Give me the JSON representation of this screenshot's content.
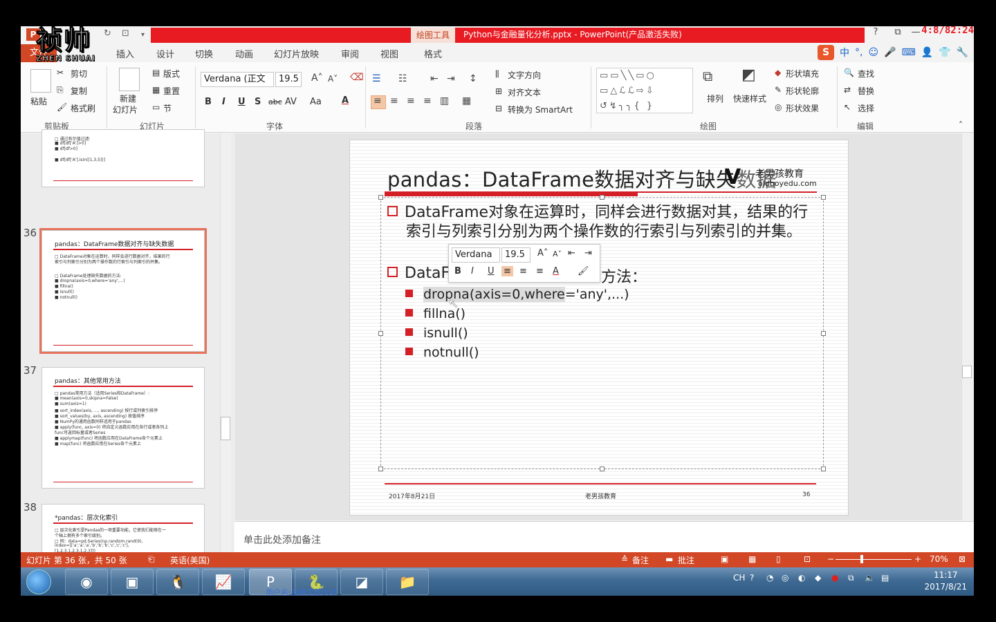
{
  "window": {
    "app_icon": "P",
    "drawing_tools_tab": "绘图工具",
    "title": "Python与金融量化分析.pptx -  PowerPoint(产品激活失败)",
    "help": "?",
    "restore": "⧉",
    "minimize": "—",
    "close": "✕",
    "overlay_timer": "4:8/82:24"
  },
  "tabs": {
    "file": "文件",
    "insert": "插入",
    "design": "设计",
    "transitions": "切换",
    "animations": "动画",
    "slideshow": "幻灯片放映",
    "review": "审阅",
    "view": "视图",
    "format": "格式"
  },
  "ime": {
    "logo": "S",
    "mode": "中"
  },
  "ribbon": {
    "clipboard": {
      "paste": "粘贴",
      "cut": "剪切",
      "copy": "复制",
      "format_painter": "格式刷",
      "label": "剪贴板"
    },
    "slides": {
      "new_slide": "新建",
      "new_slide2": "幻灯片",
      "layout": "版式",
      "reset": "重置",
      "section": "节",
      "label": "幻灯片"
    },
    "font": {
      "name": "Verdana (正文",
      "size": "19.5",
      "label": "字体",
      "bold": "B",
      "italic": "I",
      "underline": "U",
      "shadow": "S",
      "strike": "abc",
      "spacing": "AV",
      "case": "Aa",
      "color": "A"
    },
    "paragraph": {
      "text_direction": "文字方向",
      "align_text": "对齐文本",
      "smartart": "转换为 SmartArt",
      "label": "段落"
    },
    "drawing": {
      "arrange": "排列",
      "quick_styles": "快速样式",
      "shape_fill": "形状填充",
      "shape_outline": "形状轮廓",
      "shape_effects": "形状效果",
      "label": "绘图"
    },
    "editing": {
      "find": "查找",
      "replace": "替换",
      "select": "选择",
      "label": "编辑"
    }
  },
  "thumbnails": [
    {
      "number": "",
      "lines": [
        "□ 通过布尔值过滤:",
        "  ■ df[df['A']>0]",
        "  ■ df[df>0]",
        "",
        "  ■ df[df['A'].isin([1,3,5])]"
      ]
    },
    {
      "number": "36",
      "title": "pandas：DataFrame数据对齐与缺失数据",
      "lines": [
        "□ DataFrame对象在运算时，同样会进行数据对齐，结果的行",
        "   索引与列索引分别为两个操作数的行索引与列索引的并集。",
        "",
        "□ DataFrame处理缺失数据的方法:",
        "  ■ dropna(axis=0,where='any',...)",
        "  ■ fillna()",
        "  ■ isnull()",
        "  ■ notnull()"
      ]
    },
    {
      "number": "37",
      "title": "pandas：其他常用方法",
      "lines": [
        "□ pandas常用方法（适用Series和DataFrame）:",
        "  ■ mean(axis=0,skipna=False)",
        "  ■ sum(axis=1)",
        "  ■ sort_index(axis, ..., ascending)    按行或列索引排序",
        "  ■ sort_values(by, axis, ascending)    按值排序",
        "  ■ NumPy的通用函数同样适用于pandas",
        "  ■ apply(func, axis=0)     将自定义函数应用在各行或者各列上",
        "                 func可返回标量或者Series",
        "  ■ applymap(func)          将函数应用在DataFrame各个元素上",
        "  ■ map(func)               将函数应用在Series各个元素上"
      ]
    },
    {
      "number": "38",
      "title": "*pandas：层次化索引",
      "lines": [
        "□ 层次化索引是Pandas的一项重要功能，它使我们能够在一",
        "   个轴上拥有多个索引级别。",
        "□ 例：data=pd.Series(np.random.rand(9),",
        "   index=[['a','a','a','b','b','b','c','c','c'],",
        "   [1,2,3,1,2,3,1,2,3]])"
      ]
    }
  ],
  "slide": {
    "title_main": "pandas：DataFrame数据对齐与缺失",
    "title_tail": "数据",
    "logo_mark": "V",
    "logo_name": "老男孩教育",
    "logo_url": "oldboyedu.com",
    "para1_line1": "DataFrame对象在运算时，同样会进行数据对其，结果的行",
    "para1_line2": "索引与列索引分别为两个操作数的行索引与列索引的并集。",
    "para2_start": "DataF",
    "para2_end": "方法：",
    "items": [
      {
        "hl": "dropna(axis=0,where",
        "rest": "='any',...)"
      },
      {
        "hl": "",
        "rest": "fillna()"
      },
      {
        "hl": "",
        "rest": "isnull()"
      },
      {
        "hl": "",
        "rest": "notnull()"
      }
    ],
    "footer_date": "2017年8月21日",
    "footer_mid": "老男孩教育",
    "footer_page": "36"
  },
  "mini_toolbar": {
    "font": "Verdana",
    "size": "19.5"
  },
  "notes_placeholder": "单击此处添加备注",
  "status": {
    "slide_info": "幻灯片 第 36 张，共 50 张",
    "language": "英语(美国)",
    "notes": "备注",
    "comments": "批注",
    "zoom": "70%"
  },
  "taskbar": {
    "ime": "CH",
    "time": "11:17",
    "date": "2017/8/21",
    "caption": "用户名:战神无敌008"
  },
  "watermark": {
    "cn": "祯帅",
    "en": "ZHEN SHUAI"
  },
  "colors": {
    "accent": "#d24726",
    "title_red": "#e81b23",
    "slide_red": "#d31f25"
  }
}
